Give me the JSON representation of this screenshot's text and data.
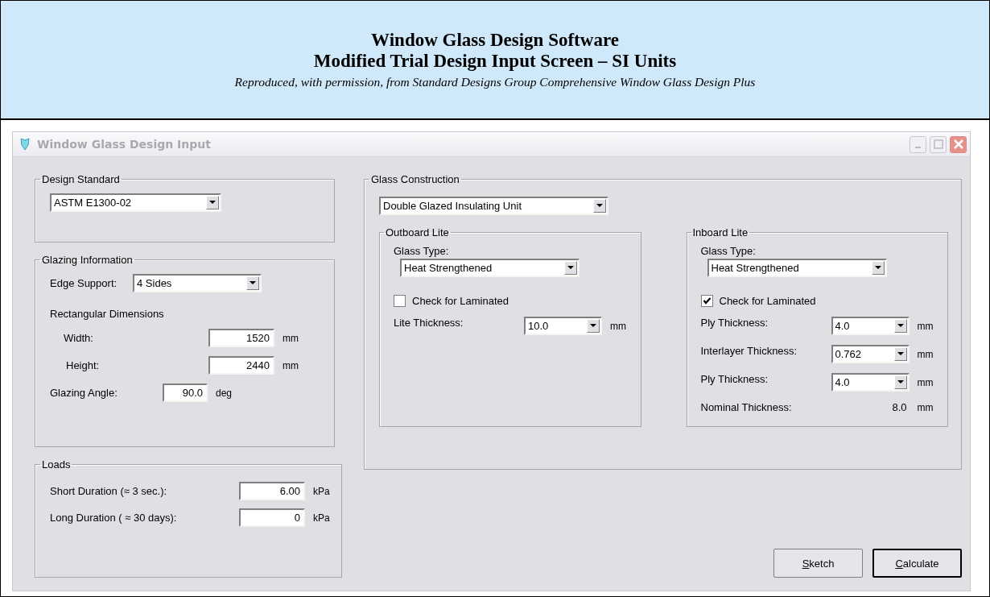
{
  "header": {
    "title_lines": [
      "Window Glass Design Software",
      "Modified Trial Design Input Screen – SI Units"
    ],
    "subtitle": "Reproduced, with permission, from Standard Designs Group Comprehensive Window Glass Design Plus"
  },
  "dialog": {
    "title": "Window Glass Design Input"
  },
  "design_standard": {
    "label": "Design Standard",
    "value": "ASTM E1300-02"
  },
  "glazing_information": {
    "label": "Glazing Information",
    "edge_support": {
      "label": "Edge Support:",
      "value": "4 Sides"
    },
    "dimensions_label": "Rectangular Dimensions",
    "fields": [
      {
        "label": "Width:",
        "value": "1520",
        "unit": "mm"
      },
      {
        "label": "Height:",
        "value": "2440",
        "unit": "mm"
      }
    ],
    "glazing_angle": {
      "label": "Glazing Angle:",
      "value": "90.0",
      "unit": "deg"
    }
  },
  "loads": {
    "label": "Loads",
    "fields": [
      {
        "label": "Short Duration (≈ 3 sec.):",
        "value": "6.00",
        "unit": "kPa"
      },
      {
        "label": "Long Duration ( ≈ 30 days):",
        "value": "0",
        "unit": "kPa"
      }
    ]
  },
  "glass_construction": {
    "label": "Glass Construction",
    "value": "Double Glazed Insulating Unit",
    "lites": [
      {
        "label": "Outboard Lite",
        "glass_type_label": "Glass Type:",
        "glass_type": "Heat Strengthened",
        "laminated": {
          "label": "Check for Laminated",
          "checked": false
        },
        "rows": [
          {
            "kind": "dropdown",
            "label": "Lite Thickness:",
            "value": "10.0",
            "unit": "mm"
          }
        ]
      },
      {
        "label": "Inboard Lite",
        "glass_type_label": "Glass Type:",
        "glass_type": "Heat Strengthened",
        "laminated": {
          "label": "Check for Laminated",
          "checked": true
        },
        "rows": [
          {
            "kind": "dropdown",
            "label": "Ply Thickness:",
            "value": "4.0",
            "unit": "mm"
          },
          {
            "kind": "dropdown",
            "label": "Interlayer Thickness:",
            "value": "0.762",
            "unit": "mm"
          },
          {
            "kind": "dropdown",
            "label": "Ply Thickness:",
            "value": "4.0",
            "unit": "mm"
          },
          {
            "kind": "readout",
            "label": "Nominal Thickness:",
            "value": "8.0",
            "unit": "mm"
          }
        ]
      }
    ]
  },
  "buttons": [
    {
      "label": "Sketch",
      "default": false
    },
    {
      "label": "Calculate",
      "default": true
    }
  ]
}
